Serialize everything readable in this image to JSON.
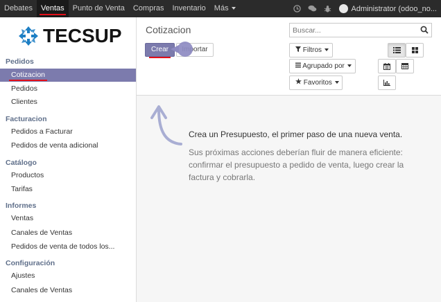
{
  "topbar": {
    "menu": [
      "Debates",
      "Ventas",
      "Punto de Venta",
      "Compras",
      "Inventario",
      "Más"
    ],
    "active": "Ventas",
    "user": "Administrator (odoo_no..."
  },
  "brand": {
    "logo_text": "TECSUP"
  },
  "sidebar": {
    "sections": [
      {
        "title": "Pedidos",
        "items": [
          "Cotizacion",
          "Pedidos",
          "Clientes"
        ]
      },
      {
        "title": "Facturacion",
        "items": [
          "Pedidos a Facturar",
          "Pedidos de venta adicional"
        ]
      },
      {
        "title": "Catálogo",
        "items": [
          "Productos",
          "Tarifas"
        ]
      },
      {
        "title": "Informes",
        "items": [
          "Ventas",
          "Canales de Ventas",
          "Pedidos de venta de todos los..."
        ]
      },
      {
        "title": "Configuración",
        "items": [
          "Ajustes",
          "Canales de Ventas"
        ]
      }
    ],
    "active_item": "Cotizacion"
  },
  "control_panel": {
    "title": "Cotizacion",
    "create_label": "Crear",
    "import_label": "Importar",
    "search_placeholder": "Buscar...",
    "filters_label": "Filtros",
    "group_by_label": "Agrupado por",
    "favorites_label": "Favoritos"
  },
  "help": {
    "headline": "Crea un Presupuesto, el primer paso de una nueva venta.",
    "body": "Sus próximas acciones deberían fluir de manera eficiente: confirmar el presupuesto a pedido de venta, luego crear la factura y cobrarla."
  },
  "colors": {
    "brand": "#7c7bad",
    "navbar": "#2b2b2b",
    "accent_red": "#e3101a"
  },
  "icons": [
    "bell-icon",
    "chat-icon",
    "bug-icon",
    "search-icon",
    "filter-icon",
    "list-icon",
    "star-icon",
    "list-view-icon",
    "kanban-view-icon",
    "calendar-view-icon",
    "pivot-view-icon",
    "graph-view-icon"
  ]
}
